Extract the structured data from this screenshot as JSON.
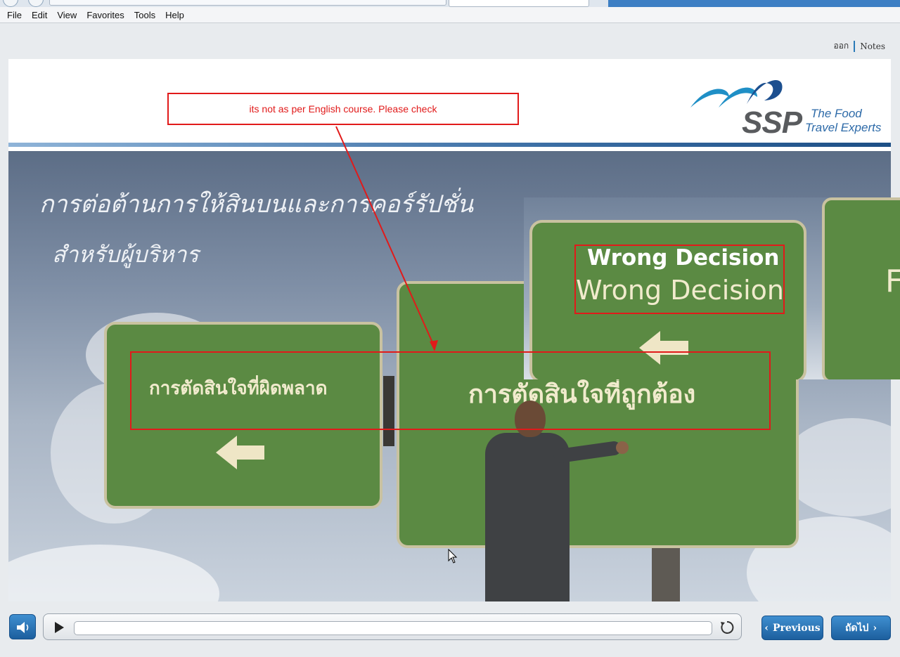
{
  "browser": {
    "menu": [
      "File",
      "Edit",
      "View",
      "Favorites",
      "Tools",
      "Help"
    ]
  },
  "player": {
    "top_links": {
      "exit": "ออก",
      "notes": "Notes"
    },
    "logo": {
      "brand": "SSP",
      "tagline_line1": "The Food",
      "tagline_line2": "Travel Experts"
    },
    "slide": {
      "title_line1": "การต่อต้านการให้สินบนและการคอร์รัปชั่น",
      "title_line2": "สำหรับผู้บริหาร",
      "sign_left": "การตัดสินใจที่ผิดพลาด",
      "sign_right": "การตัดสินใจที่ถูกต้อง"
    },
    "review_comment": "its not as per English course. Please check",
    "english_reference": {
      "title_white": "Wrong Decision",
      "title_cream": "Wrong Decision",
      "partial_letter": "F"
    },
    "progress": 0,
    "nav": {
      "previous": "Previous",
      "next": "ถัดไป"
    },
    "colors": {
      "accent": "#2a7ab8",
      "button": "#1c5f9e",
      "sign_green": "#5b8a43",
      "annotation_red": "#e11a1a"
    }
  }
}
